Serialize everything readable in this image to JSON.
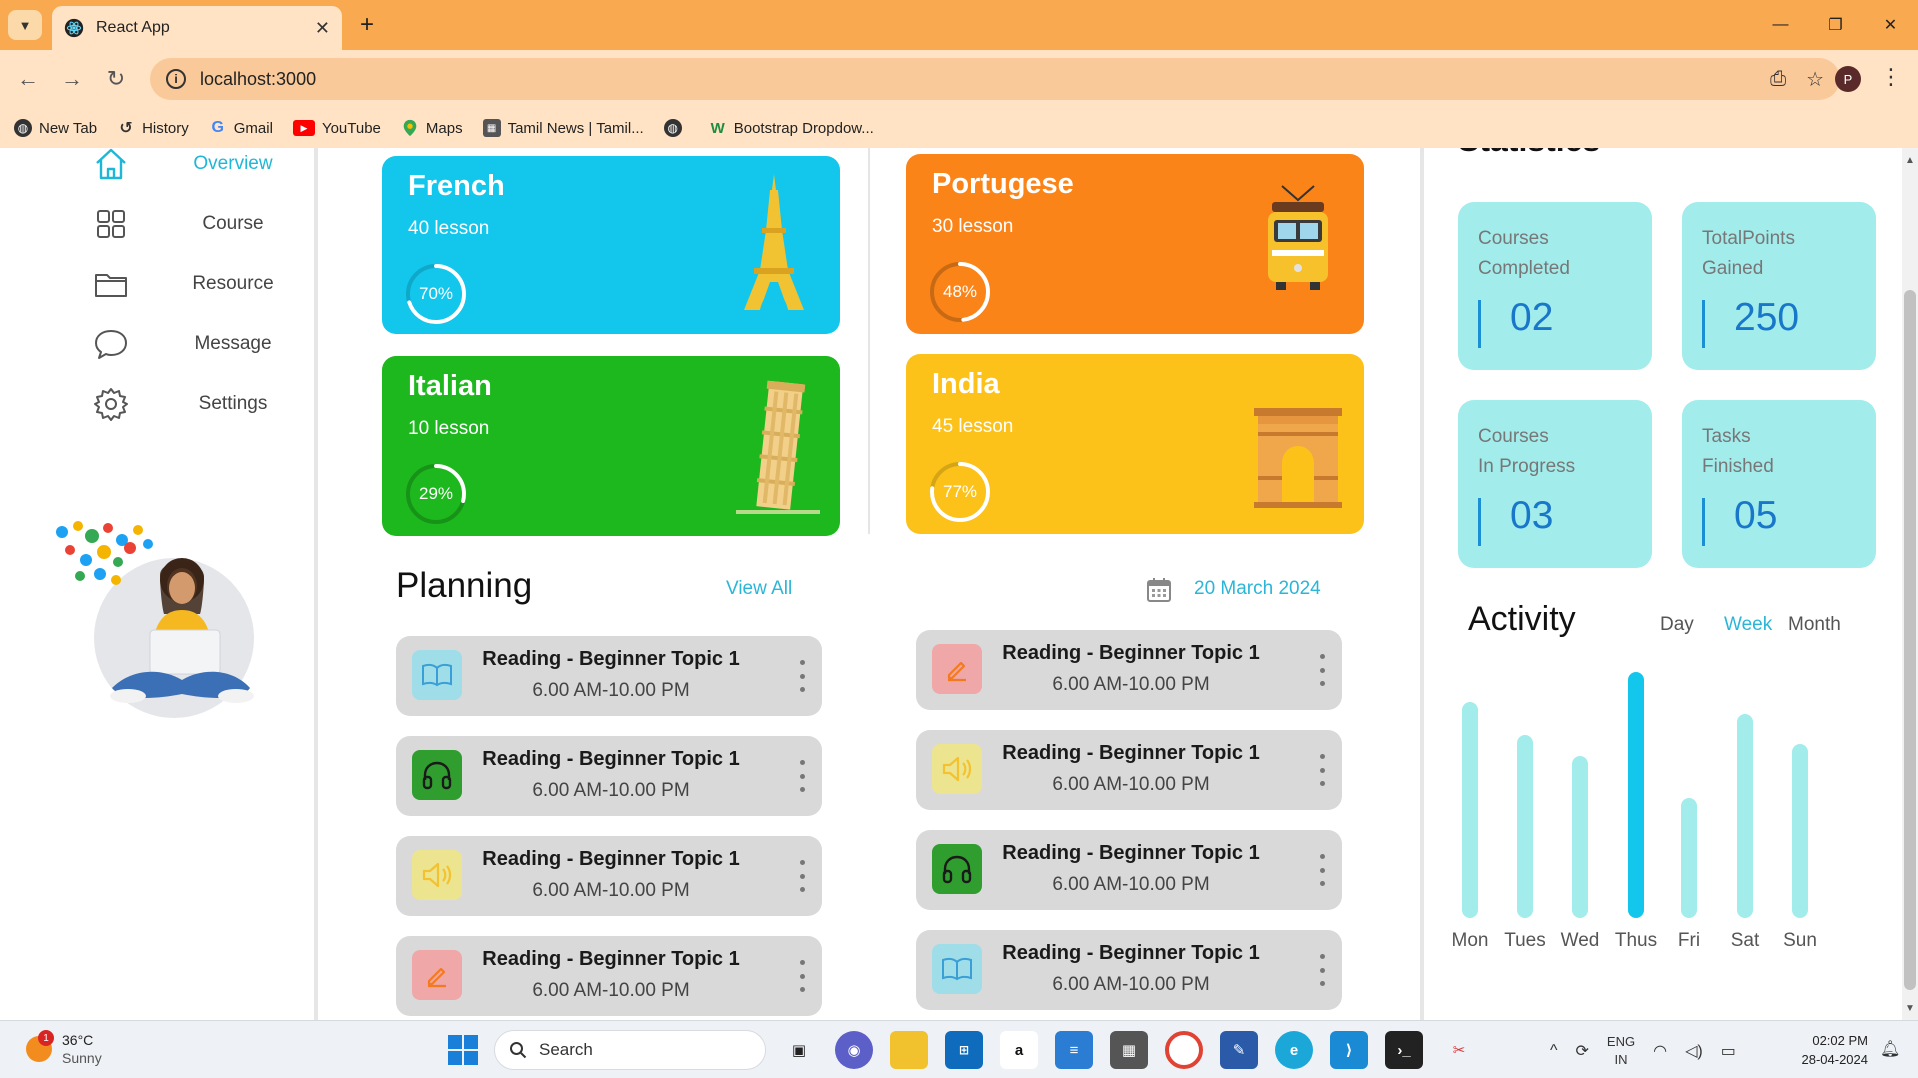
{
  "browser": {
    "tab_title": "React App",
    "url": "localhost:3000",
    "profile_initial": "P",
    "bookmarks": [
      {
        "label": "New Tab",
        "icon": "globe-icon"
      },
      {
        "label": "History",
        "icon": "history-icon"
      },
      {
        "label": "Gmail",
        "icon": "google-icon"
      },
      {
        "label": "YouTube",
        "icon": "youtube-icon"
      },
      {
        "label": "Maps",
        "icon": "maps-pin-icon"
      },
      {
        "label": "Tamil News | Tamil...",
        "icon": "news-icon"
      },
      {
        "label": "",
        "icon": "globe-icon"
      },
      {
        "label": "Bootstrap Dropdow...",
        "icon": "w-icon"
      }
    ]
  },
  "sidebar": {
    "items": [
      {
        "label": "Overview",
        "icon": "home-icon",
        "active": true
      },
      {
        "label": "Course",
        "icon": "grid-icon",
        "active": false
      },
      {
        "label": "Resource",
        "icon": "folder-icon",
        "active": false
      },
      {
        "label": "Message",
        "icon": "chat-icon",
        "active": false
      },
      {
        "label": "Settings",
        "icon": "gear-icon",
        "active": false
      }
    ]
  },
  "courses": [
    {
      "name": "French",
      "lessons": "40 lesson",
      "progress": 70,
      "progress_label": "70%",
      "color": "#12c6ec",
      "art": "eiffel-tower-icon"
    },
    {
      "name": "Portugese",
      "lessons": "30 lesson",
      "progress": 48,
      "progress_label": "48%",
      "color": "#fb8419",
      "art": "tram-icon"
    },
    {
      "name": "Italian",
      "lessons": "10 lesson",
      "progress": 29,
      "progress_label": "29%",
      "color": "#1db81d",
      "art": "leaning-tower-icon"
    },
    {
      "name": "India",
      "lessons": "45 lesson",
      "progress": 77,
      "progress_label": "77%",
      "color": "#fcc21a",
      "art": "india-gate-icon"
    }
  ],
  "planning": {
    "title": "Planning",
    "view_all": "View All",
    "date": "20 March 2024",
    "left": [
      {
        "title": "Reading - Beginner Topic 1",
        "time": "6.00 AM-10.00 PM",
        "icon": "book-icon"
      },
      {
        "title": "Reading - Beginner Topic 1",
        "time": "6.00 AM-10.00 PM",
        "icon": "headphones-icon"
      },
      {
        "title": "Reading - Beginner Topic 1",
        "time": "6.00 AM-10.00 PM",
        "icon": "speaker-icon"
      },
      {
        "title": "Reading - Beginner Topic 1",
        "time": "6.00 AM-10.00 PM",
        "icon": "pencil-icon"
      }
    ],
    "right": [
      {
        "title": "Reading - Beginner Topic 1",
        "time": "6.00 AM-10.00 PM",
        "icon": "pencil-icon"
      },
      {
        "title": "Reading - Beginner Topic 1",
        "time": "6.00 AM-10.00 PM",
        "icon": "speaker-icon"
      },
      {
        "title": "Reading - Beginner Topic 1",
        "time": "6.00 AM-10.00 PM",
        "icon": "headphones-icon"
      },
      {
        "title": "Reading - Beginner Topic 1",
        "time": "6.00 AM-10.00 PM",
        "icon": "book-icon"
      }
    ]
  },
  "statistics": {
    "title": "Statistics",
    "cards": [
      {
        "line1": "Courses",
        "line2": "Completed",
        "value": "02"
      },
      {
        "line1": "TotalPoints",
        "line2": "Gained",
        "value": "250"
      },
      {
        "line1": "Courses",
        "line2": "In Progress",
        "value": "03"
      },
      {
        "line1": "Tasks",
        "line2": "Finished",
        "value": "05"
      }
    ]
  },
  "activity": {
    "title": "Activity",
    "tabs": [
      {
        "label": "Day",
        "active": false
      },
      {
        "label": "Week",
        "active": true
      },
      {
        "label": "Month",
        "active": false
      }
    ]
  },
  "chart_data": {
    "type": "bar",
    "categories": [
      "Mon",
      "Tues",
      "Wed",
      "Thus",
      "Fri",
      "Sat",
      "Sun"
    ],
    "values": [
      72,
      61,
      54,
      82,
      40,
      68,
      58
    ],
    "highlight": "Thus",
    "colors": {
      "bar": "#a3ecec",
      "highlight": "#12c6ec"
    }
  },
  "taskbar": {
    "weather_temp": "36°C",
    "weather_desc": "Sunny",
    "weather_badge": "1",
    "search_placeholder": "Search",
    "lang_line1": "ENG",
    "lang_line2": "IN",
    "time": "02:02 PM",
    "date": "28-04-2024"
  }
}
